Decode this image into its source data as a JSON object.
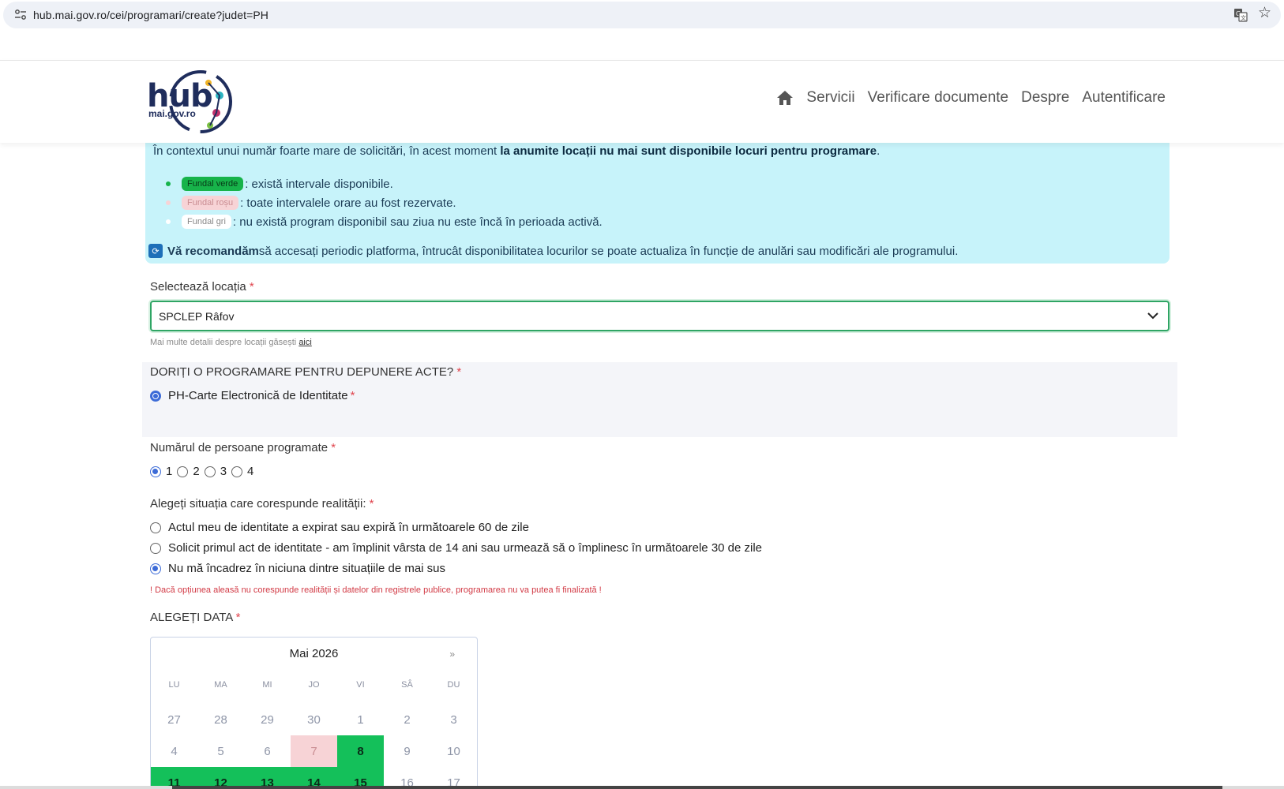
{
  "browser": {
    "url": "hub.mai.gov.ro/cei/programari/create?judet=PH",
    "site_icon": "tune-icon",
    "translate_icon": "translate-icon",
    "bookmark_icon": "star-icon"
  },
  "header": {
    "logo_word": "hub",
    "logo_sub": "mai.gov.ro",
    "nav": {
      "home_icon": "home-icon",
      "items": [
        "Servicii",
        "Verificare documente",
        "Despre",
        "Autentificare"
      ]
    }
  },
  "info": {
    "intro_plain": "În contextul unui număr foarte mare de solicitări, în acest moment ",
    "intro_bold": "la anumite locații nu mai sunt disponibile locuri pentru programare",
    "intro_end": ".",
    "legend": [
      {
        "pill": "Fundal verde",
        "text": ": există intervale disponibile.",
        "color": "#17b34a"
      },
      {
        "pill": "Fundal roșu",
        "text": ": toate intervalele orare au fost rezervate.",
        "color": "#f7d3d6"
      },
      {
        "pill": "Fundal gri",
        "text": ": nu există program disponibil sau ziua nu este încă în perioada activă.",
        "color": "#ffffff"
      }
    ],
    "recommend_bold": "Vă recomandăm",
    "recommend_text": " să accesați periodic platforma, întrucât disponibilitatea locurilor se poate actualiza în funcție de anulări sau modificări ale programului."
  },
  "form": {
    "location_label": "Selectează locația",
    "required_mark": "*",
    "location_value": "SPCLEP Râfov",
    "hint_text": "Mai multe detalii despre locații găsești ",
    "hint_link": "aici",
    "doc_question": "DORIȚI O PROGRAMARE PENTRU DEPUNERE ACTE?",
    "doc_option": "PH-Carte Electronică de Identitate",
    "persons_label": "Numărul de persoane programate",
    "persons_options": [
      "1",
      "2",
      "3",
      "4"
    ],
    "persons_selected": "1",
    "situation_label": "Alegeți situația care corespunde realității:",
    "situations": [
      "Actul meu de identitate a expirat sau expiră în următoarele 60 de zile",
      "Solicit primul act de identitate - am împlinit vârsta de 14 ani sau urmează să o împlinesc în următoarele 30 de zile",
      "Nu mă încadrez în niciuna dintre situațiile de mai sus"
    ],
    "situation_selected": 2,
    "warning": "! Dacă opțiunea aleasă nu corespunde realității și datelor din registrele publice, programarea nu va putea fi finalizată !",
    "date_label": "ALEGEȚI DATA"
  },
  "calendar": {
    "month": "Mai 2026",
    "next": "»",
    "weekdays": [
      "LU",
      "MA",
      "MI",
      "JO",
      "VI",
      "SÂ",
      "DU"
    ],
    "weeks": [
      [
        {
          "d": "27",
          "s": "gray"
        },
        {
          "d": "28",
          "s": "gray"
        },
        {
          "d": "29",
          "s": "gray"
        },
        {
          "d": "30",
          "s": "gray"
        },
        {
          "d": "1",
          "s": "gray"
        },
        {
          "d": "2",
          "s": "gray"
        },
        {
          "d": "3",
          "s": "gray"
        }
      ],
      [
        {
          "d": "4",
          "s": "gray"
        },
        {
          "d": "5",
          "s": "gray"
        },
        {
          "d": "6",
          "s": "gray"
        },
        {
          "d": "7",
          "s": "red"
        },
        {
          "d": "8",
          "s": "green"
        },
        {
          "d": "9",
          "s": "gray"
        },
        {
          "d": "10",
          "s": "gray"
        }
      ],
      [
        {
          "d": "11",
          "s": "green"
        },
        {
          "d": "12",
          "s": "green"
        },
        {
          "d": "13",
          "s": "green"
        },
        {
          "d": "14",
          "s": "green"
        },
        {
          "d": "15",
          "s": "green"
        },
        {
          "d": "16",
          "s": "gray"
        },
        {
          "d": "17",
          "s": "gray"
        }
      ]
    ]
  }
}
